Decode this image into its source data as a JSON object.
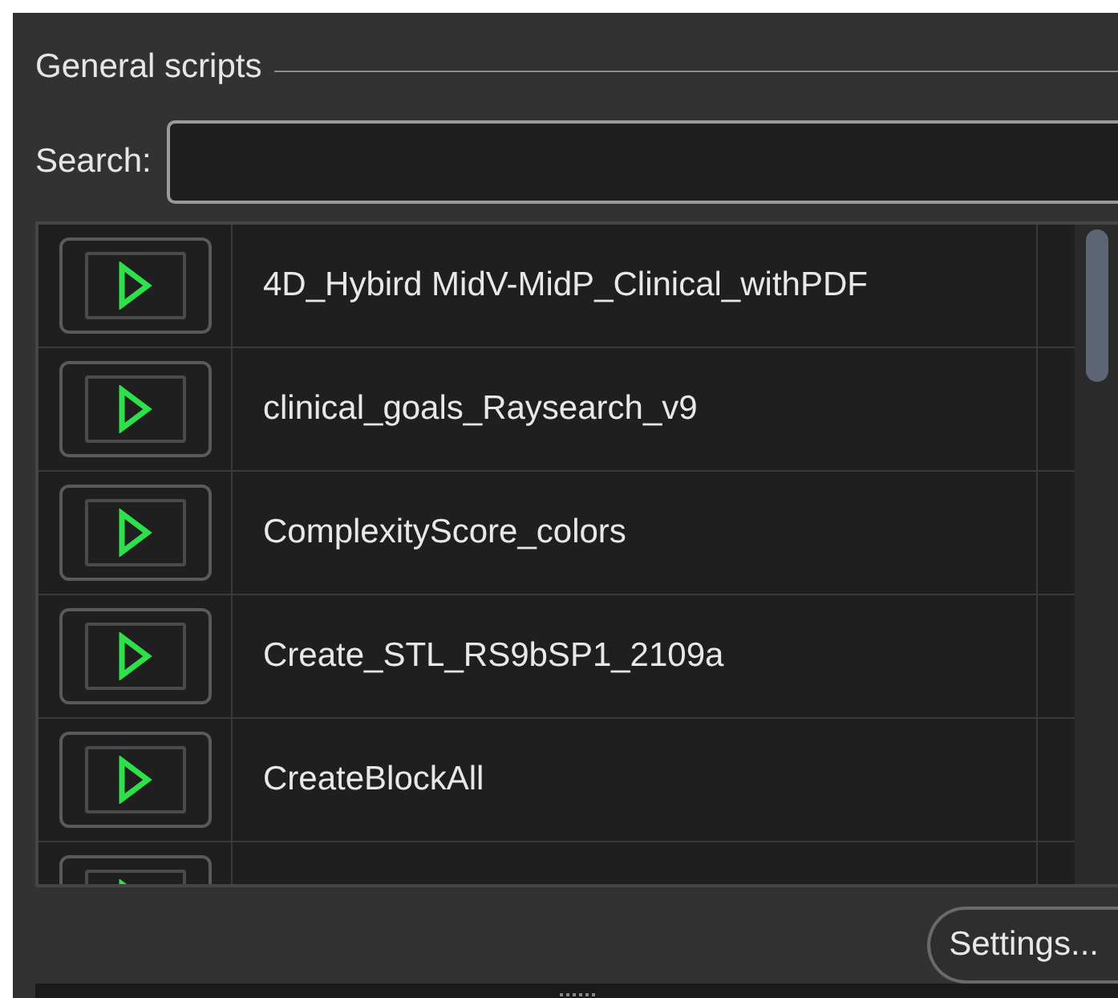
{
  "group": {
    "title": "General scripts"
  },
  "search": {
    "label": "Search:"
  },
  "scripts": [
    {
      "kind": "full",
      "name": "4D_Hybird MidV-MidP_Clinical_withPDF"
    },
    {
      "kind": "full",
      "name": "clinical_goals_Raysearch_v9"
    },
    {
      "kind": "full",
      "name": "ComplexityScore_colors"
    },
    {
      "kind": "full",
      "name": "Create_STL_RS9bSP1_2109a"
    },
    {
      "kind": "full",
      "name": "CreateBlockAll"
    },
    {
      "kind": "partial"
    }
  ],
  "buttons": {
    "settings": "Settings..."
  }
}
